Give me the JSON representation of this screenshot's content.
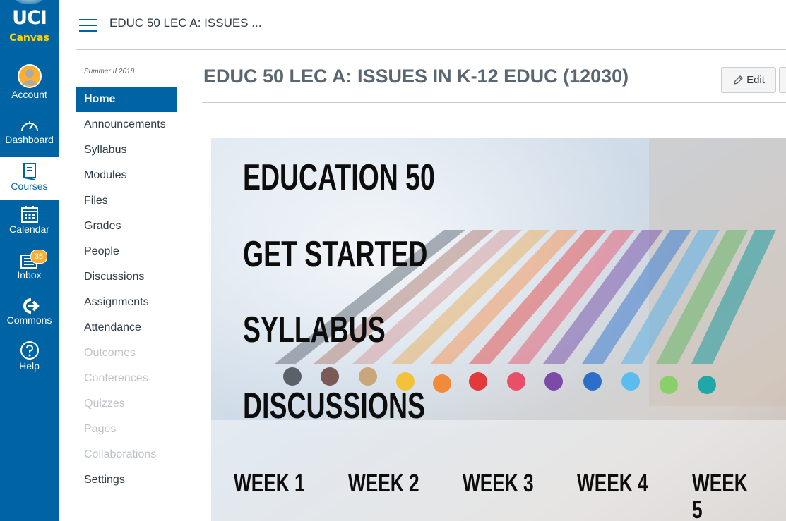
{
  "global_nav": {
    "logo": {
      "line1": "UCI",
      "line2": "Canvas"
    },
    "items": [
      {
        "label": "Account",
        "icon": "account-icon"
      },
      {
        "label": "Dashboard",
        "icon": "dashboard-icon"
      },
      {
        "label": "Courses",
        "icon": "courses-icon",
        "active": true
      },
      {
        "label": "Calendar",
        "icon": "calendar-icon"
      },
      {
        "label": "Inbox",
        "icon": "inbox-icon",
        "badge": "35"
      },
      {
        "label": "Commons",
        "icon": "commons-icon"
      },
      {
        "label": "Help",
        "icon": "help-icon"
      }
    ]
  },
  "header": {
    "breadcrumb": "EDUC 50 LEC A: ISSUES ..."
  },
  "course_nav": {
    "term": "Summer II 2018",
    "items": [
      {
        "label": "Home",
        "state": "active"
      },
      {
        "label": "Announcements",
        "state": "enabled"
      },
      {
        "label": "Syllabus",
        "state": "enabled"
      },
      {
        "label": "Modules",
        "state": "enabled"
      },
      {
        "label": "Files",
        "state": "enabled"
      },
      {
        "label": "Grades",
        "state": "enabled"
      },
      {
        "label": "People",
        "state": "enabled"
      },
      {
        "label": "Discussions",
        "state": "enabled"
      },
      {
        "label": "Assignments",
        "state": "enabled"
      },
      {
        "label": "Attendance",
        "state": "enabled"
      },
      {
        "label": "Outcomes",
        "state": "disabled"
      },
      {
        "label": "Conferences",
        "state": "disabled"
      },
      {
        "label": "Quizzes",
        "state": "disabled"
      },
      {
        "label": "Pages",
        "state": "disabled"
      },
      {
        "label": "Collaborations",
        "state": "disabled"
      },
      {
        "label": "Settings",
        "state": "enabled"
      }
    ]
  },
  "main": {
    "title": "EDUC 50 LEC A: ISSUES IN K-12 EDUC (12030)",
    "edit_label": "Edit",
    "banner": {
      "links": [
        "EDUCATION 50",
        "GET STARTED",
        "SYLLABUS",
        "DISCUSSIONS"
      ],
      "weeks": [
        "WEEK 1",
        "WEEK 2",
        "WEEK 3",
        "WEEK 4",
        "WEEK 5"
      ]
    }
  },
  "colors": {
    "brand": "#0064a4",
    "accent": "#ffd200",
    "badge": "#fbb034"
  }
}
